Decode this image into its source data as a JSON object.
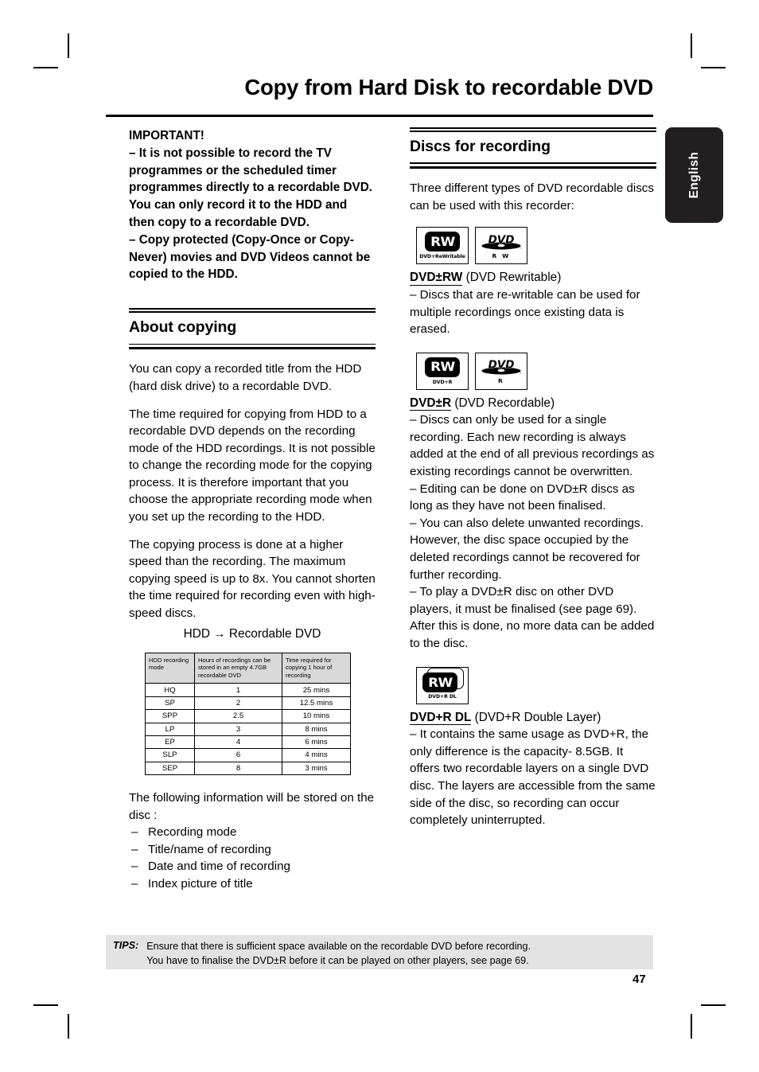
{
  "chapter": {
    "title": "Copy from Hard Disk to recordable DVD"
  },
  "language_tab": {
    "label": "English"
  },
  "left_column": {
    "important": {
      "heading": "IMPORTANT!",
      "paragraphs": [
        "– It is not possible to record the TV programmes or the scheduled timer programmes directly to a recordable DVD.  You can only record it to the HDD and then copy to a recordable DVD.",
        "– Copy protected (Copy-Once or Copy-Never) movies and DVD Videos cannot be copied to the HDD."
      ]
    },
    "about_copying": {
      "heading": "About copying",
      "paragraphs": [
        "You can copy a recorded title from the HDD (hard disk drive) to a recordable DVD.",
        "The time required for copying from HDD to a recordable DVD depends on the recording mode of the HDD recordings. It is not possible to change the recording mode for the copying process. It is therefore important that you choose the appropriate recording mode when you set up the recording to the HDD.",
        "The copying process is done at a higher speed than the recording. The maximum copying speed is up to 8x.  You cannot shorten the time required for recording even with high-speed discs."
      ],
      "table_caption": "HDD → Recordable DVD",
      "table": {
        "headers": [
          "HDD recording mode",
          "Hours of recordings can be stored in an empty 4.7GB recordable DVD",
          "Time required for copying 1 hour of recording"
        ],
        "rows": [
          [
            "HQ",
            "1",
            "25 mins"
          ],
          [
            "SP",
            "2",
            "12.5 mins"
          ],
          [
            "SPP",
            "2.5",
            "10 mins"
          ],
          [
            "LP",
            "3",
            "8 mins"
          ],
          [
            "EP",
            "4",
            "6 mins"
          ],
          [
            "SLP",
            "6",
            "4 mins"
          ],
          [
            "SEP",
            "8",
            "3 mins"
          ]
        ]
      },
      "stored_intro": "The following information will be stored on the disc :",
      "stored_items": [
        "Recording mode",
        "Title/name of recording",
        "Date and time of recording",
        "Index picture of title"
      ],
      "dash": "–"
    }
  },
  "right_column": {
    "discs_for_recording": {
      "heading": "Discs for recording",
      "intro": "Three different types of DVD recordable discs can be used with this recorder:",
      "entries": [
        {
          "logo_rw_caption": "DVD+ReWritable",
          "logo_rw_text": "RW",
          "logo_dvd_text": "DVD",
          "logo_dvd_caption": "R W",
          "title_bold": "DVD±RW",
          "title_rest": " (DVD Rewritable)",
          "body": "– Discs that are re-writable can be used for multiple recordings once existing data is erased."
        },
        {
          "logo_rw_caption": "DVD+R",
          "logo_rw_text": "RW",
          "logo_dvd_text": "DVD",
          "logo_dvd_caption": "R",
          "title_bold": "DVD±R",
          "title_rest": " (DVD Recordable)",
          "body": "– Discs can only be used for a single recording. Each new recording is always added at the end of all previous recordings as existing recordings cannot be overwritten.\n– Editing can be done on DVD±R discs as long as they have not been finalised.\n– You can also delete unwanted recordings. However, the disc space occupied by the deleted recordings cannot be recovered for further recording.\n– To play a DVD±R disc on other DVD players, it must be finalised (see page 69). After this is done, no more data can be added to the disc."
        },
        {
          "logo_rw_caption": "DVD+R DL",
          "logo_rw_text": "RW",
          "title_bold": "DVD+R DL",
          "title_rest": " (DVD+R Double Layer)",
          "body": "– It contains the same usage as DVD+R, the only difference is the capacity- 8.5GB. It offers two recordable layers on a single DVD disc.  The layers are accessible from the same side of the disc, so recording can occur completely uninterrupted."
        }
      ]
    }
  },
  "tips": {
    "label": "TIPS:",
    "lines": [
      "Ensure that there is sufficient space available on the recordable DVD before recording.",
      "You have to finalise the DVD±R before it can be played on other players, see page 69."
    ]
  },
  "page_number": "47",
  "colors": {
    "ink": "#000000",
    "tips_background": "#e3e3e3",
    "table_header_background": "#d9d9d9",
    "tab_background": "#231f20"
  }
}
